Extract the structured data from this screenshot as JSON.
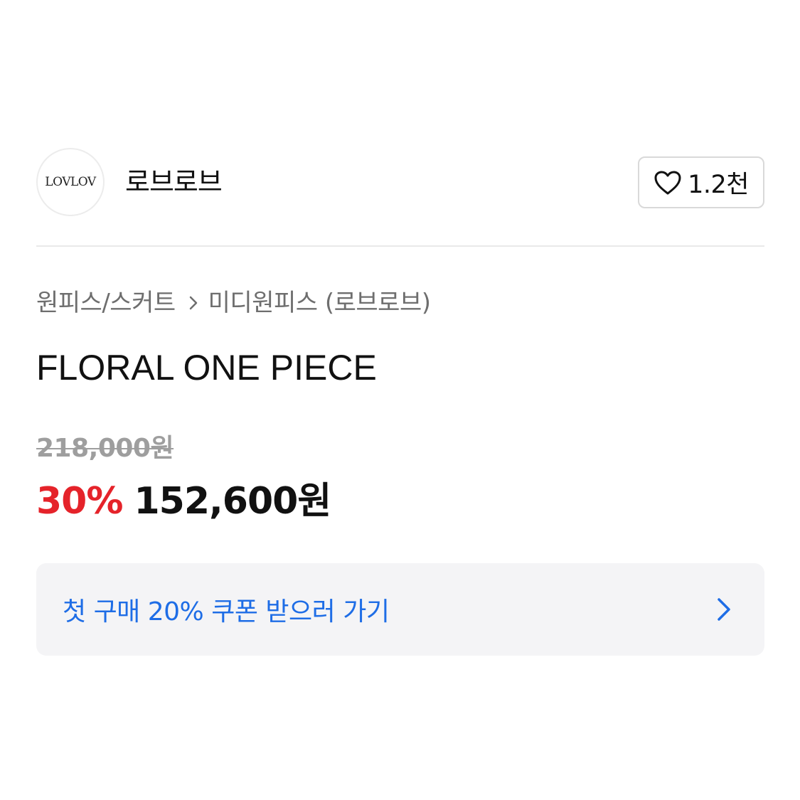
{
  "shop": {
    "logo_text": "LOVLOV",
    "name": "로브로브",
    "like_count": "1.2천"
  },
  "breadcrumb": {
    "category": "원피스/스커트",
    "subcategory": "미디원피스 (로브로브)"
  },
  "product": {
    "title": "FLORAL ONE PIECE",
    "original_price": "218,000원",
    "discount_rate": "30%",
    "sale_price": "152,600원"
  },
  "coupon": {
    "label": "첫 구매 20% 쿠폰 받으러 가기"
  },
  "colors": {
    "discount": "#e5232a",
    "coupon_text": "#1e6de6",
    "coupon_bg": "#f4f4f6"
  },
  "icons": {
    "like": "heart-outline-icon",
    "breadcrumb_separator": "chevron-right-icon",
    "coupon_arrow": "chevron-right-icon"
  }
}
